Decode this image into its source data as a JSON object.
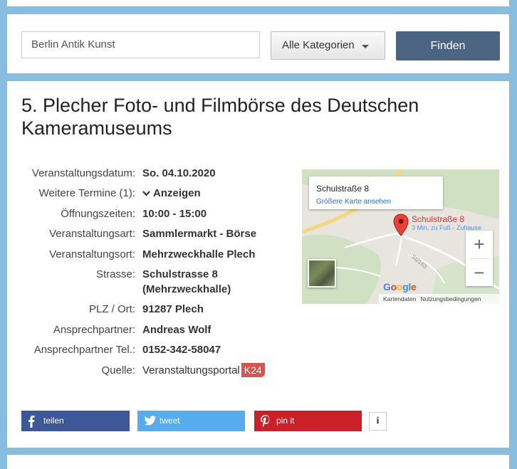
{
  "search": {
    "value": "Berlin Antik Kunst",
    "category": "Alle Kategorien",
    "button_label": "Finden"
  },
  "event": {
    "title": "5. Plecher Foto- und Filmbörse des Deutschen Kameramuseums",
    "rows": [
      {
        "label": "Veranstaltungsdatum:",
        "value": "So. 04.10.2020"
      },
      {
        "label": "Weitere Termine (1):",
        "value": "Anzeigen"
      },
      {
        "label": "Öffnungszeiten:",
        "value": "10:00 - 15:00"
      },
      {
        "label": "Veranstaltungsart:",
        "value": "Sammlermarkt - Börse"
      },
      {
        "label": "Veranstaltungsort:",
        "value": "Mehrzweckhalle Plech"
      },
      {
        "label": "Strasse:",
        "value": "Schulstrasse 8 (Mehrzweckhalle)"
      },
      {
        "label": "PLZ / Ort:",
        "value": "91287 Plech"
      },
      {
        "label": "Ansprechpartner:",
        "value": "Andreas Wolf"
      },
      {
        "label": "Ansprechpartner Tel.:",
        "value": "0152-342-58047"
      },
      {
        "label": "Quelle:",
        "value": "Veranstaltungsportal",
        "badge": "K24"
      }
    ]
  },
  "map": {
    "card_title": "Schulstraße 8",
    "card_link": "Größere Karte ansehen",
    "place_label": "Schulstraße 8",
    "place_sub": "3 Min. zu Fuß - Zuhause",
    "road_label": "St2163",
    "zoom_in": "+",
    "zoom_out": "−",
    "logo": "Google",
    "footer_data": "Kartendaten",
    "footer_terms": "Nutzungsbedingungen"
  },
  "share": {
    "facebook": "teilen",
    "twitter": "tweet",
    "pinterest": "pin it",
    "info": "i"
  },
  "colors": {
    "page_bg": "#86bde0",
    "find_button": "#4a6482",
    "facebook": "#3b5998",
    "twitter": "#55acee",
    "pinterest": "#cb2027",
    "badge": "#d9534f"
  }
}
